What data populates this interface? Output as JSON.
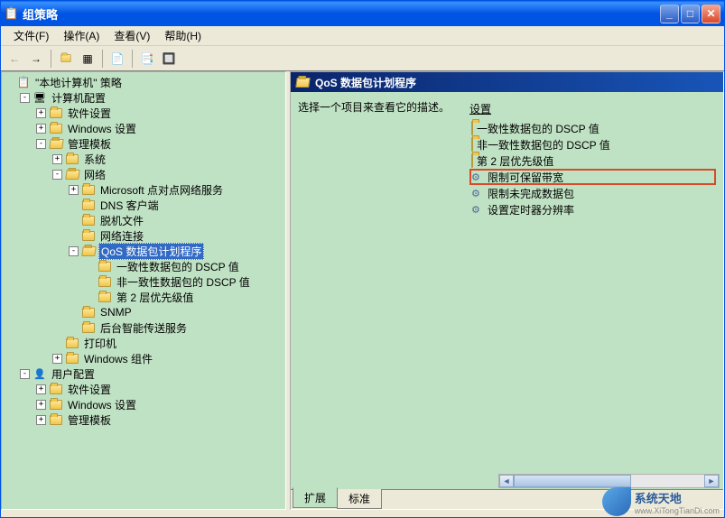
{
  "window": {
    "title": "组策略"
  },
  "menu": {
    "file": "文件(F)",
    "action": "操作(A)",
    "view": "查看(V)",
    "help": "帮助(H)"
  },
  "tree": {
    "root": "\"本地计算机\" 策略",
    "computer": "计算机配置",
    "software": "软件设置",
    "windows_set": "Windows 设置",
    "admin_tpl": "管理模板",
    "system": "系统",
    "network": "网络",
    "ms_p2p": "Microsoft 点对点网络服务",
    "dns": "DNS 客户端",
    "offline": "脱机文件",
    "netconn": "网络连接",
    "qos": "QoS 数据包计划程序",
    "dscp1": "一致性数据包的 DSCP 值",
    "dscp2": "非一致性数据包的 DSCP 值",
    "layer2": "第 2 层优先级值",
    "snmp": "SNMP",
    "bits": "后台智能传送服务",
    "printer": "打印机",
    "win_comp": "Windows 组件",
    "user": "用户配置",
    "u_software": "软件设置",
    "u_windows": "Windows 设置",
    "u_admin": "管理模板"
  },
  "right": {
    "title": "QoS 数据包计划程序",
    "desc": "选择一个项目来查看它的描述。",
    "col_header": "设置",
    "items": {
      "i0": "一致性数据包的 DSCP 值",
      "i1": "非一致性数据包的 DSCP 值",
      "i2": "第 2 层优先级值",
      "i3": "限制可保留带宽",
      "i4": "限制未完成数据包",
      "i5": "设置定时器分辨率"
    }
  },
  "tabs": {
    "extend": "扩展",
    "standard": "标准"
  },
  "watermark": "系统天地",
  "watermark_sub": "www.XiTongTianDi.com"
}
